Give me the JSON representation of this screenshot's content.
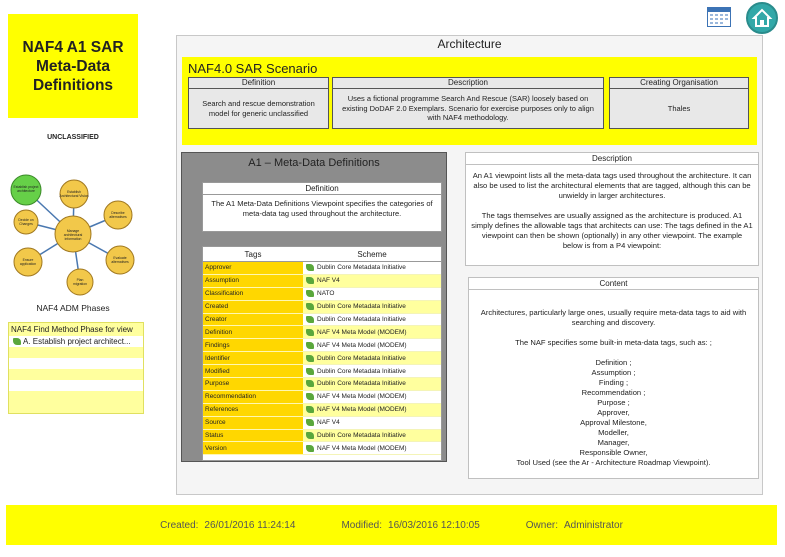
{
  "left": {
    "title": "NAF4 A1 SAR\nMeta-Data\nDefinitions",
    "classification": "UNCLASSIFIED",
    "diagram": {
      "center": "Manage architectural information and feedback",
      "nodes": [
        "Establish project architecture Catalogue",
        "Establish Architectural Vision",
        "Describe alternatives at architectures",
        "Evaluate alternatives at architecture and get trade-off",
        "Plan migration",
        "Ensure application of Architecture",
        "Decide on architecture Changes"
      ]
    },
    "diagram_caption": "NAF4 ADM Phases",
    "find_panel": {
      "header": "NAF4 Find Method Phase for view",
      "item": "A. Establish project architect..."
    }
  },
  "icons": {
    "calendar": "calendar-icon",
    "home": "home-icon"
  },
  "main": {
    "title": "Architecture",
    "scenario": {
      "title": "NAF4.0 SAR Scenario",
      "definition_header": "Definition",
      "definition": "Search and rescue demonstration model for generic unclassified",
      "description_header": "Description",
      "description": "Uses a fictional programme Search And Rescue (SAR) loosely based on existing DoDAF 2.0 Exemplars. Scenario for exercise purposes only to align with NAF4 methodology.",
      "org_header": "Creating Organisation",
      "org": "Thales"
    },
    "a1": {
      "title": "A1 – Meta-Data Definitions",
      "definition_header": "Definition",
      "definition": "The A1 Meta-Data Definitions Viewpoint specifies the categories of meta-data tag used throughout the architecture.",
      "tags_header": "Tags",
      "scheme_header": "Scheme",
      "rows": [
        {
          "tag": "Approver",
          "scheme": "Dublin Core Metadata Initiative"
        },
        {
          "tag": "Assumption",
          "scheme": "NAF V4"
        },
        {
          "tag": "Classification",
          "scheme": "NATO"
        },
        {
          "tag": "Created",
          "scheme": "Dublin Core Metadata Initiative"
        },
        {
          "tag": "Creator",
          "scheme": "Dublin Core Metadata Initiative"
        },
        {
          "tag": "Definition",
          "scheme": "NAF V4 Meta Model (MODEM)"
        },
        {
          "tag": "Findings",
          "scheme": "NAF V4 Meta Model (MODEM)"
        },
        {
          "tag": "Identifier",
          "scheme": "Dublin Core Metadata Initiative"
        },
        {
          "tag": "Modified",
          "scheme": "Dublin Core Metadata Initiative"
        },
        {
          "tag": "Purpose",
          "scheme": "Dublin Core Metadata Initiative"
        },
        {
          "tag": "Recommendation",
          "scheme": "NAF V4 Meta Model (MODEM)"
        },
        {
          "tag": "References",
          "scheme": "NAF V4 Meta Model (MODEM)"
        },
        {
          "tag": "Source",
          "scheme": "NAF V4"
        },
        {
          "tag": "Status",
          "scheme": "Dublin Core Metadata Initiative"
        },
        {
          "tag": "Version",
          "scheme": "NAF V4 Meta Model (MODEM)"
        }
      ]
    },
    "description_panel": {
      "header": "Description",
      "body": "An A1 viewpoint lists all the meta-data tags used throughout the architecture.  It can also be used to list the architectural elements that are tagged, although this can be unwieldy in larger architectures.\n\nThe tags themselves are usually assigned as the architecture is produced. A1 simply defines the allowable tags that architects can use: The tags defined in the A1 viewpoint can then be shown (optionally) in any other viewpoint. The example below is from a P4 viewpoint:"
    },
    "content_panel": {
      "header": "Content",
      "body": "Architectures, particularly large ones, usually require meta-data tags to aid with searching and discovery.\n\nThe NAF specifies some built-in meta-data tags, such as: ;\n\nDefinition ;\nAssumption ;\nFinding ;\nRecommendation ;\nPurpose ;\nApprover,\nApproval Milestone,\nModeller,\nManager,\nResponsible Owner,\nTool Used (see the Ar - Architecture Roadmap Viewpoint)."
    }
  },
  "footer": {
    "created_label": "Created:",
    "created_value": "26/01/2016 11:24:14",
    "modified_label": "Modified:",
    "modified_value": "16/03/2016 12:10:05",
    "owner_label": "Owner:",
    "owner_value": "Administrator"
  }
}
